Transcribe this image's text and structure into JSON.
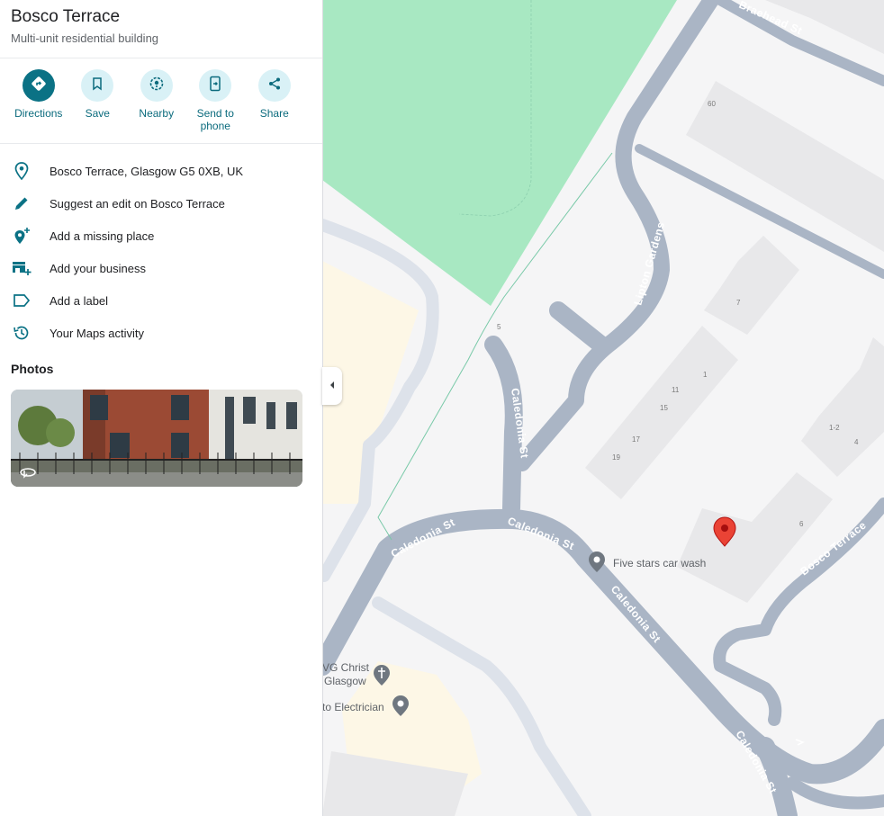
{
  "place": {
    "title": "Bosco Terrace",
    "subtitle": "Multi-unit residential building"
  },
  "actions": [
    {
      "label": "Directions",
      "icon": "directions-icon"
    },
    {
      "label": "Save",
      "icon": "bookmark-icon"
    },
    {
      "label": "Nearby",
      "icon": "nearby-icon"
    },
    {
      "label": "Send to phone",
      "icon": "send-to-phone-icon"
    },
    {
      "label": "Share",
      "icon": "share-icon"
    }
  ],
  "info": [
    {
      "text": "Bosco Terrace, Glasgow G5 0XB, UK",
      "icon": "location-pin-icon"
    },
    {
      "text": "Suggest an edit on Bosco Terrace",
      "icon": "pencil-icon"
    },
    {
      "text": "Add a missing place",
      "icon": "add-place-icon"
    },
    {
      "text": "Add your business",
      "icon": "add-business-icon"
    },
    {
      "text": "Add a label",
      "icon": "label-icon"
    },
    {
      "text": "Your Maps activity",
      "icon": "history-icon"
    }
  ],
  "photos": {
    "heading": "Photos"
  },
  "map": {
    "roads": {
      "braehead": "Braehead St",
      "lipton": "Lipton Gardens",
      "caledonia_vertical": "Caledonia St",
      "caledonia_left": "Caledonia St",
      "caledonia_right": "Caledonia St",
      "caledonia_diag": "Caledonia St",
      "caledonia_bottom": "Caledonia St",
      "bosco": "Bosco Terrace"
    },
    "pois": {
      "car_wash": "Five stars car wash",
      "church_line1": "VG Christ",
      "church_line2": "Glasgow",
      "electrician": "to Electrician"
    },
    "numbers": {
      "n60": "60",
      "n7": "7",
      "n5": "5",
      "n1": "1",
      "n11": "11",
      "n15": "15",
      "n17": "17",
      "n19": "19",
      "n12": "1-2",
      "n4": "4",
      "n6": "6"
    },
    "colors": {
      "park": "#a8e8c2",
      "road": "#aab5c5",
      "building": "#e8e8ea",
      "pin": "#ea4335",
      "accent": "#0b7285"
    }
  }
}
